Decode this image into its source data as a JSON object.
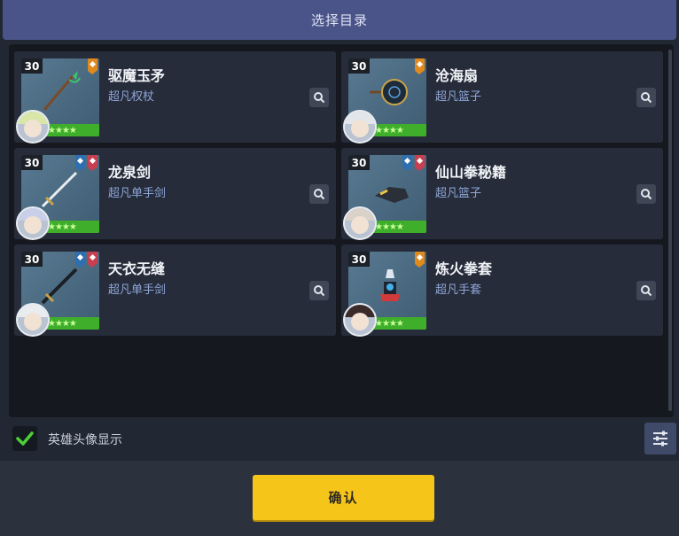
{
  "dialog": {
    "title": "选择目录",
    "show_hero_avatar_label": "英雄头像显示",
    "show_hero_avatar_checked": true,
    "confirm_label": "确认"
  },
  "items": [
    {
      "level": "30",
      "name": "驱魔玉矛",
      "type": "超凡权杖",
      "stars": "★★★★",
      "badges": [
        "orange"
      ],
      "weapon_icon": "spear-icon",
      "avatar_hair": "#d8e6a8"
    },
    {
      "level": "30",
      "name": "沧海扇",
      "type": "超凡篮子",
      "stars": "★★★★",
      "badges": [
        "orange"
      ],
      "weapon_icon": "fan-icon",
      "avatar_hair": "#e3e6ea"
    },
    {
      "level": "30",
      "name": "龙泉剑",
      "type": "超凡单手剑",
      "stars": "★★★★",
      "badges": [
        "blue",
        "red"
      ],
      "weapon_icon": "sword-icon",
      "avatar_hair": "#c9cfe8"
    },
    {
      "level": "30",
      "name": "仙山拳秘籍",
      "type": "超凡篮子",
      "stars": "★★★★",
      "badges": [
        "blue",
        "red"
      ],
      "weapon_icon": "scroll-icon",
      "avatar_hair": "#d9d2c9"
    },
    {
      "level": "30",
      "name": "天衣无缝",
      "type": "超凡单手剑",
      "stars": "★★★★",
      "badges": [
        "blue",
        "red"
      ],
      "weapon_icon": "blade-icon",
      "avatar_hair": "#e8ecef"
    },
    {
      "level": "30",
      "name": "炼火拳套",
      "type": "超凡手套",
      "stars": "★★★★",
      "badges": [
        "orange"
      ],
      "weapon_icon": "gauntlet-icon",
      "avatar_hair": "#3a2a2a"
    }
  ],
  "colors": {
    "header": "#4b5488",
    "accent_yellow": "#f6c51a",
    "type_text": "#8fa6d8",
    "check_green": "#4cd137"
  }
}
